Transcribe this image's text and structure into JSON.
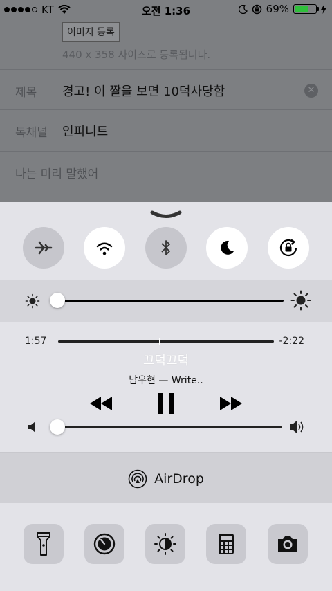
{
  "status_bar": {
    "carrier": "KT",
    "time": "오전 1:36",
    "battery_percent": "69%",
    "battery_level": 0.69,
    "signal_bars_filled": 4
  },
  "background_app": {
    "image_register_label": "이미지 등록",
    "image_size_hint": "440 x 358 사이즈로 등록됩니다.",
    "fields": [
      {
        "label": "제목",
        "value": "경고! 이 짤을 보면 10덕사당함"
      },
      {
        "label": "톡채널",
        "value": "인피니트"
      },
      {
        "label": "나는 미리 말했어",
        "value": ""
      }
    ]
  },
  "control_center": {
    "toggles": [
      {
        "icon": "airplane-icon",
        "on": false
      },
      {
        "icon": "wifi-icon",
        "on": true
      },
      {
        "icon": "bluetooth-icon",
        "on": false
      },
      {
        "icon": "moon-icon",
        "on": true
      },
      {
        "icon": "rotation-lock-icon",
        "on": true
      }
    ],
    "brightness": {
      "level": 0.02
    },
    "music": {
      "elapsed": "1:57",
      "remaining": "-2:22",
      "progress": 0.47,
      "title": "끄덕끄덕",
      "artist": "남우현 — Write..",
      "volume": 0.02
    },
    "airdrop_label": "AirDrop",
    "shortcuts": [
      "flashlight-icon",
      "timer-icon",
      "night-shift-icon",
      "calculator-icon",
      "camera-icon"
    ]
  }
}
